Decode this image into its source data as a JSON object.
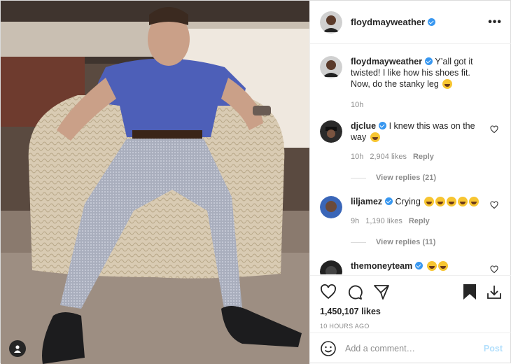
{
  "post": {
    "author": "floydmayweather",
    "author_verified": true,
    "more_icon": "more-options-icon"
  },
  "caption": {
    "username": "floydmayweather",
    "text": "Y’all got it twisted! I like how his shoes fit. Now, do the stanky leg",
    "time": "10h"
  },
  "comments": [
    {
      "username": "djclue",
      "text": "I knew this was on the way",
      "time": "10h",
      "likes": "2,904 likes",
      "reply": "Reply",
      "view_replies": "View replies (21)"
    },
    {
      "username": "liljamez",
      "text": "Crying",
      "time": "9h",
      "likes": "1,190 likes",
      "reply": "Reply",
      "view_replies": "View replies (11)"
    },
    {
      "username": "themoneyteam",
      "text": ""
    }
  ],
  "stats": {
    "likes": "1,450,107 likes",
    "posted": "10 HOURS AGO"
  },
  "add_comment": {
    "placeholder": "Add a comment…",
    "post_label": "Post"
  },
  "colors": {
    "verified": "#3897f0",
    "post_disabled": "#b2dffc",
    "muted": "#8e8e8e"
  }
}
